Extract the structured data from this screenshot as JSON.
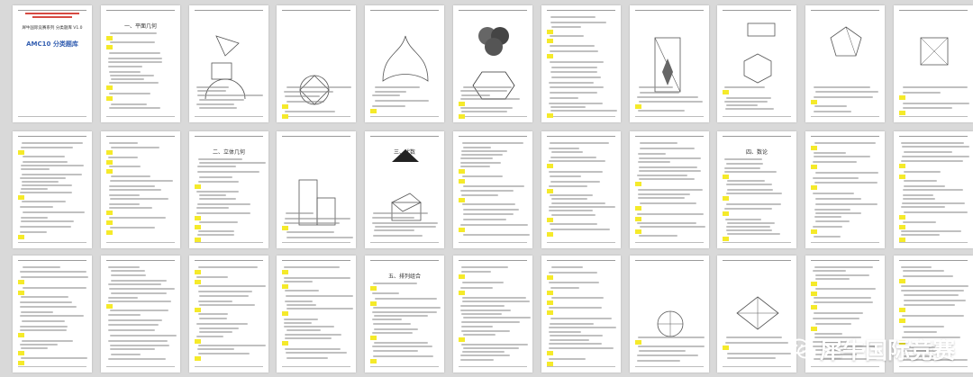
{
  "cover": {
    "subtitle": "犀牛国际竞赛系列 分类题库 V1.0",
    "title": "AMC10 分类题库"
  },
  "sections": [
    {
      "page_index": 1,
      "label": "一、平面几何"
    },
    {
      "page_index": 13,
      "label": "二、立体几何"
    },
    {
      "page_index": 15,
      "label": "三、代数"
    },
    {
      "page_index": 19,
      "label": "四、数论"
    },
    {
      "page_index": 26,
      "label": "五、排列组合"
    }
  ],
  "watermark": {
    "icon": "wechat-icon",
    "text": "犀牛国际竞赛"
  }
}
